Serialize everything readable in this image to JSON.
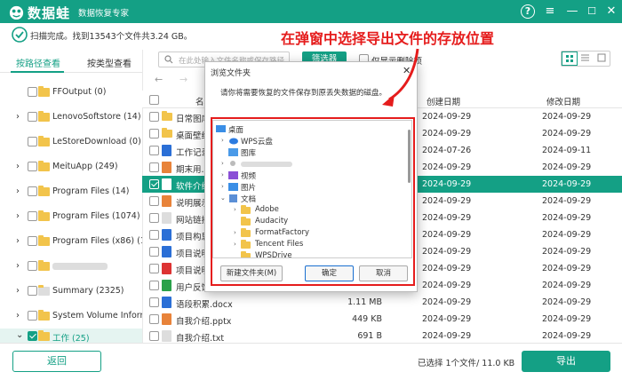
{
  "app": {
    "name": "数据蛙",
    "subtitle": "数据恢复专家",
    "help": "?",
    "min": "—",
    "max": "☐",
    "close": "✕"
  },
  "status": {
    "text": "扫描完成。找到13543个文件共3.24 GB。"
  },
  "annotation": "在弹窗中选择导出文件的存放位置",
  "tabs": {
    "by_path": "按路径查看",
    "by_type": "按类型查看"
  },
  "tree": [
    {
      "label": "FFOutput (0)",
      "expand": false
    },
    {
      "label": "LenovoSoftstore (14)",
      "expand": true
    },
    {
      "label": "LeStoreDownload (0)",
      "expand": false
    },
    {
      "label": "MeituApp (249)",
      "expand": true
    },
    {
      "label": "Program Files (14)",
      "expand": true
    },
    {
      "label": "Program Files (1074)",
      "expand": true
    },
    {
      "label": "Program Files (x86) (1976",
      "expand": true
    },
    {
      "label": "",
      "expand": true
    },
    {
      "label": "Summary (2325)",
      "expand": true
    },
    {
      "label": "System Volume Informati",
      "expand": true
    },
    {
      "label": "工作 (25)",
      "expand": true
    }
  ],
  "toolbar": {
    "search_placeholder": "在此处输入文件名称或保存路径",
    "filter": "筛选器",
    "show_deleted": "仅显示删除项"
  },
  "columns": {
    "name": "名称",
    "created": "创建日期",
    "modified": "修改日期"
  },
  "files": [
    {
      "name": "日常图库",
      "size": "",
      "type": "",
      "created": "2024-09-29",
      "modified": "2024-09-29",
      "icon": "#f2c44b"
    },
    {
      "name": "桌面壁纸",
      "size": "",
      "type": "",
      "created": "2024-09-29",
      "modified": "2024-09-29",
      "icon": "#f2c44b"
    },
    {
      "name": "工作记录1.",
      "size": "",
      "type": "",
      "created": "2024-07-26",
      "modified": "2024-09-11",
      "icon": "#2b6fd6"
    },
    {
      "name": "期末用.ppt",
      "size": "",
      "type": "",
      "created": "2024-09-29",
      "modified": "2024-09-29",
      "icon": "#e8833a"
    },
    {
      "name": "软件介绍",
      "size": "",
      "type": "",
      "created": "2024-09-29",
      "modified": "2024-09-29",
      "icon": "#2b6fd6"
    },
    {
      "name": "说明展示.p",
      "size": "",
      "type": "",
      "created": "2024-09-29",
      "modified": "2024-09-29",
      "icon": "#e8833a"
    },
    {
      "name": "网站链接.t",
      "size": "",
      "type": "",
      "created": "2024-09-29",
      "modified": "2024-09-29",
      "icon": "#bbb"
    },
    {
      "name": "项目构思.d",
      "size": "",
      "type": "",
      "created": "2024-09-29",
      "modified": "2024-09-29",
      "icon": "#2b6fd6"
    },
    {
      "name": "项目说明书",
      "size": "",
      "type": "",
      "created": "2024-09-29",
      "modified": "2024-09-29",
      "icon": "#2b6fd6"
    },
    {
      "name": "项目说明书",
      "size": "",
      "type": "",
      "created": "2024-09-29",
      "modified": "2024-09-29",
      "icon": "#d33"
    },
    {
      "name": "用户反馈数据",
      "size": "",
      "type": "",
      "created": "2024-09-29",
      "modified": "2024-09-29",
      "icon": "#2aa14a"
    },
    {
      "name": "语段积累.docx",
      "size": "1.11 MB",
      "type": "",
      "created": "2024-09-29",
      "modified": "2024-09-29",
      "icon": "#2b6fd6"
    },
    {
      "name": "自我介绍.pptx",
      "size": "449 KB",
      "type": "",
      "created": "2024-09-29",
      "modified": "2024-09-29",
      "icon": "#e8833a"
    },
    {
      "name": "自我介绍.txt",
      "size": "691 B",
      "type": "",
      "created": "2024-09-29",
      "modified": "2024-09-29",
      "icon": "#bbb"
    }
  ],
  "bottom": {
    "back": "返回",
    "selected": "已选择 1个文件/ 11.0 KB",
    "export": "导出"
  },
  "dialog": {
    "title": "浏览文件夹",
    "close": "✕",
    "message": "请你将需要恢复的文件保存到原丢失数据的磁盘。",
    "tree": [
      {
        "label": "桌面",
        "indent": 0,
        "arrow": "",
        "icon": "desktop"
      },
      {
        "label": "WPS云盘",
        "indent": 1,
        "arrow": "›",
        "icon": "cloud"
      },
      {
        "label": "图库",
        "indent": 1,
        "arrow": "",
        "icon": "gallery"
      },
      {
        "label": "",
        "indent": 1,
        "arrow": "›",
        "icon": "user"
      },
      {
        "label": "视频",
        "indent": 1,
        "arrow": "›",
        "icon": "video"
      },
      {
        "label": "图片",
        "indent": 1,
        "arrow": "›",
        "icon": "picture"
      },
      {
        "label": "文档",
        "indent": 1,
        "arrow": "⌄",
        "icon": "docs"
      },
      {
        "label": "Adobe",
        "indent": 2,
        "arrow": "›",
        "icon": "folder"
      },
      {
        "label": "Audacity",
        "indent": 2,
        "arrow": "",
        "icon": "folder"
      },
      {
        "label": "FormatFactory",
        "indent": 2,
        "arrow": "›",
        "icon": "folder"
      },
      {
        "label": "Tencent Files",
        "indent": 2,
        "arrow": "›",
        "icon": "folder"
      },
      {
        "label": "WPSDrive",
        "indent": 2,
        "arrow": "",
        "icon": "folder"
      }
    ],
    "new_folder": "新建文件夹(M)",
    "ok": "确定",
    "cancel": "取消"
  }
}
